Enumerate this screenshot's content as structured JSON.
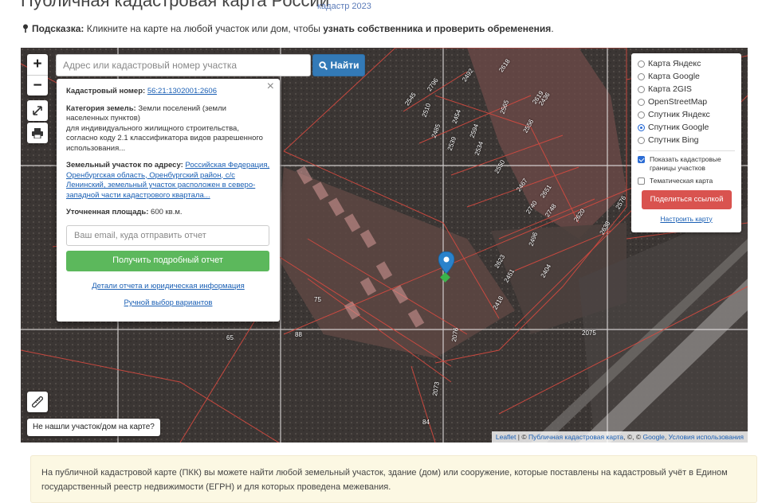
{
  "page": {
    "title": "Публичная кадастровая карта России",
    "title_extra": "кадастр 2023",
    "hint_label": "Подсказка:",
    "hint_text": "Кликните на карте на любой участок или дом, чтобы",
    "hint_bold": "узнать собственника и проверить обременения",
    "hint_end": "."
  },
  "map": {
    "zoom_in": "+",
    "zoom_out": "−",
    "search_placeholder": "Адрес или кадастровый номер участка",
    "search_button": "Найти",
    "not_found": "Не нашли участок/дом на карте?",
    "attribution": {
      "leaflet": "Leaflet",
      "sep1": " | © ",
      "pkk": "Публичная кадастровая карта",
      "sep2": ", ©, © ",
      "google": "Google",
      "sep3": ", ",
      "terms": "Условия использования"
    },
    "parcel_labels": [
      "2796",
      "2492",
      "2618",
      "2619",
      "2545",
      "2510",
      "2485",
      "2454",
      "2594",
      "2534",
      "2539",
      "2565",
      "2556",
      "2550",
      "2576",
      "2467",
      "2651",
      "2740",
      "2620",
      "2748",
      "2638",
      "2496",
      "2623",
      "2451",
      "2418",
      "2404",
      "2436",
      "2073",
      "2075",
      "2076",
      "75",
      "65",
      "84",
      "88"
    ],
    "icons": {
      "fullscreen": "expand-icon",
      "print": "print-icon",
      "ruler": "ruler-icon",
      "marker": "map-marker-icon"
    }
  },
  "info_popup": {
    "cadastral_label": "Кадастровый номер:",
    "cadastral_value": "56:21:1302001:2606",
    "category_label": "Категория земель:",
    "category_value": "Земли поселений (земли населенных пунктов)",
    "usage_text": "для индивидуального жилищного строительства, согласно коду 2.1 классификатора видов разрешенного использования...",
    "address_label": "Земельный участок по адресу:",
    "address_value": "Российская Федерация, Оренбургская область, Оренбургский район, с/с Ленинский, земельный участок расположен в северо-западной части кадастрового квартала...",
    "area_label": "Уточненная площадь:",
    "area_value": "600 кв.м.",
    "email_placeholder": "Ваш email, куда отправить отчет",
    "report_button": "Получить подробный отчет",
    "details_link": "Детали отчета и юридическая информация",
    "manual_link": "Ручной выбор вариантов",
    "close": "×"
  },
  "layers_panel": {
    "options": [
      {
        "label": "Карта Яндекс",
        "selected": false
      },
      {
        "label": "Карта Google",
        "selected": false
      },
      {
        "label": "Карта 2GIS",
        "selected": false
      },
      {
        "label": "OpenStreetMap",
        "selected": false
      },
      {
        "label": "Спутник Яндекс",
        "selected": false
      },
      {
        "label": "Спутник Google",
        "selected": true
      },
      {
        "label": "Спутник Bing",
        "selected": false
      }
    ],
    "show_cadastral": "Показать кадастровые границы участков",
    "show_cadastral_checked": true,
    "thematic": "Тематическая карта",
    "thematic_checked": false,
    "share_button": "Поделиться ссылкой",
    "setup_link": "Настроить карту"
  },
  "notice": {
    "text": "На публичной кадастровой карте (ПКК) вы можете найти любой земельный участок, здание (дом) или сооружение, которые поставлены на кадастровый учёт в Едином государственный реестр недвижимости (ЕГРН) и для которых проведена межевания."
  },
  "colors": {
    "primary": "#337ab7",
    "success": "#5cb85c",
    "danger": "#d9534f",
    "link": "#1a5fb4",
    "parcel_line": "#c0392b",
    "notice_bg": "#fcf8e3"
  }
}
